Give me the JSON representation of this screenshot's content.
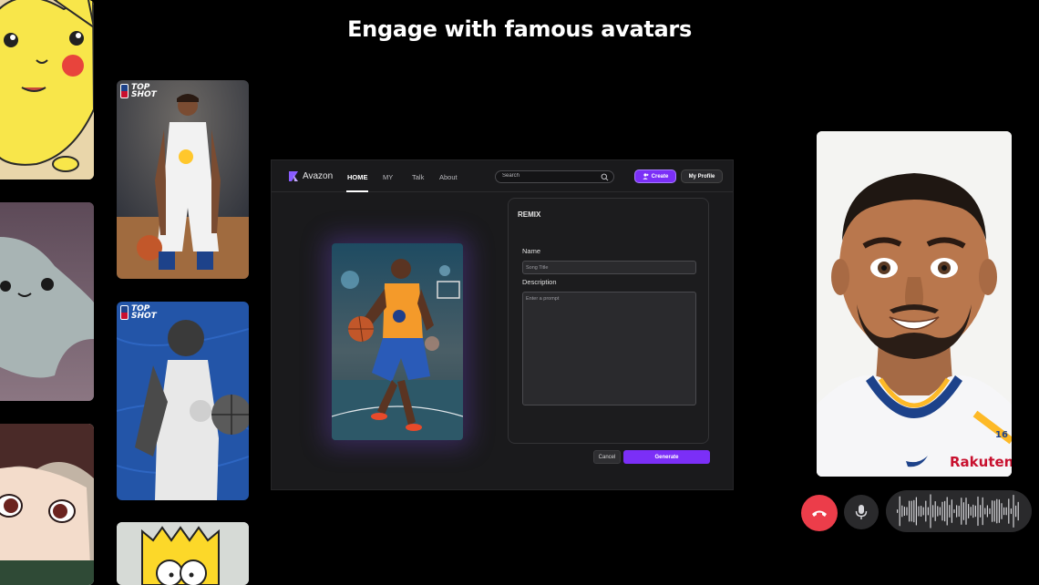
{
  "headline": "Engage with famous avatars",
  "left_cards": [
    {
      "name": "pikachu"
    },
    {
      "name": "star-character"
    },
    {
      "name": "anime-boy"
    }
  ],
  "player_cards": [
    {
      "badge": "TOP SHOT"
    },
    {
      "badge": "TOP SHOT"
    }
  ],
  "app": {
    "brand": "Avazon",
    "nav": [
      {
        "label": "HOME",
        "active": true
      },
      {
        "label": "MY"
      },
      {
        "label": "Talk"
      },
      {
        "label": "About"
      }
    ],
    "search": {
      "placeholder": "Search"
    },
    "create_label": "Create",
    "profile_label": "My Profile",
    "remix": {
      "title": "REMIX",
      "name_label": "Name",
      "name_placeholder": "Song Title",
      "description_label": "Description",
      "description_placeholder": "Enter a prompt"
    },
    "cancel_label": "Cancel",
    "generate_label": "Generate"
  },
  "call": {
    "jersey_text": "Rakuten",
    "jersey_number": "16",
    "controls": [
      "end-call-icon",
      "microphone-icon",
      "audio-waveform"
    ]
  },
  "colors": {
    "accent": "#7B2FF7",
    "end_call": "#EC3D4A",
    "background": "#000000"
  }
}
